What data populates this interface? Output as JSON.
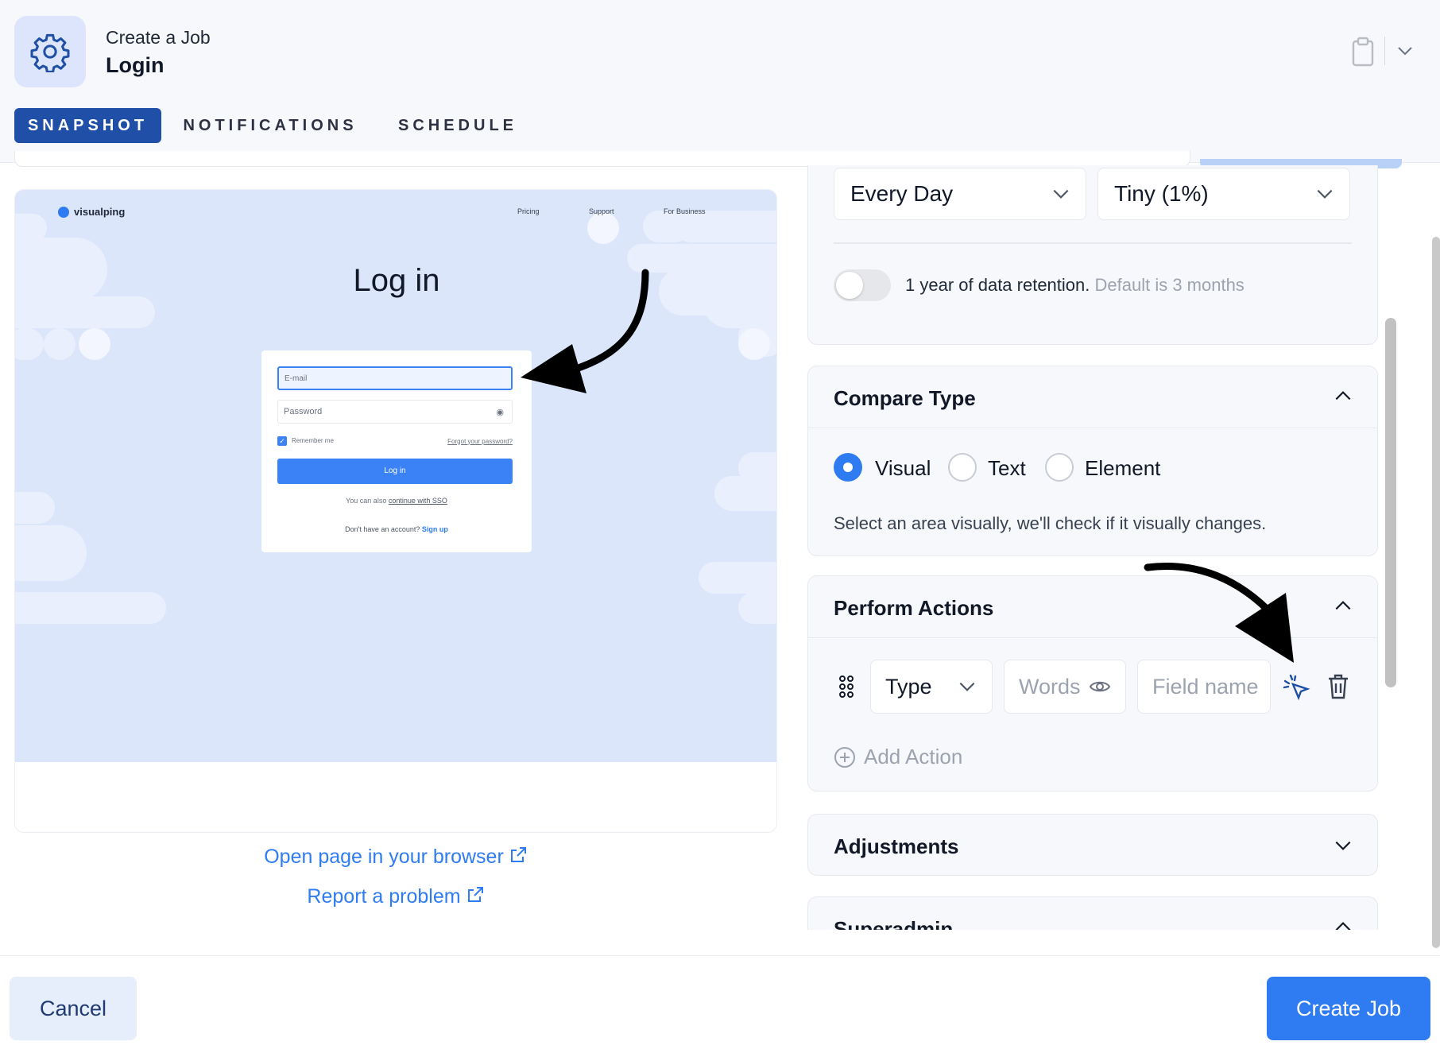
{
  "header": {
    "subtitle": "Create a Job",
    "title": "Login",
    "tabs": [
      {
        "label": "SNAPSHOT",
        "active": true
      },
      {
        "label": "NOTIFICATIONS",
        "active": false
      },
      {
        "label": "SCHEDULE",
        "active": false
      }
    ],
    "icons": [
      "gear-icon",
      "clipboard-icon",
      "chevron-down-icon"
    ]
  },
  "preview": {
    "site_logo": "visualping",
    "site_nav": [
      "Pricing",
      "Support",
      "For Business"
    ],
    "heading": "Log in",
    "email_placeholder": "E-mail",
    "password_placeholder": "Password",
    "remember_me": "Remember me",
    "forgot_password": "Forgot your password?",
    "login_button": "Log in",
    "sso_prefix": "You can also",
    "sso_link": "continue with SSO",
    "signup_prefix": "Don't have an account?",
    "signup_link": "Sign up",
    "open_link": "Open page in your browser",
    "report_link": "Report a problem"
  },
  "settings": {
    "frequency": "Every Day",
    "threshold": "Tiny (1%)",
    "retention_label": "1 year of data retention.",
    "retention_hint": "Default is 3 months",
    "retention_enabled": false
  },
  "compare_type": {
    "title": "Compare Type",
    "options": [
      "Visual",
      "Text",
      "Element"
    ],
    "selected": "Visual",
    "description": "Select an area visually, we'll check if it visually changes."
  },
  "perform_actions": {
    "title": "Perform Actions",
    "action_type": "Type",
    "words_placeholder": "Words",
    "field_placeholder": "Field name",
    "add_action": "Add Action"
  },
  "adjustments": {
    "title": "Adjustments"
  },
  "superadmin": {
    "title": "Superadmin"
  },
  "footer": {
    "cancel": "Cancel",
    "create": "Create Job"
  },
  "colors": {
    "accent": "#2f7cf2",
    "tab_active": "#1f4fa6",
    "preview_bg": "#dce6fb"
  }
}
